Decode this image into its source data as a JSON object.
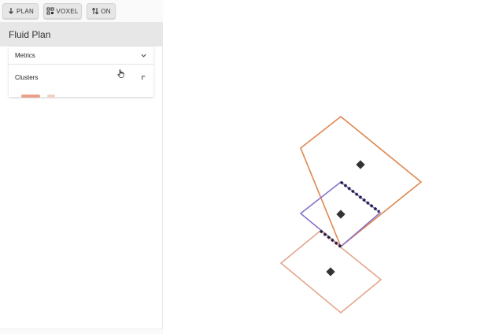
{
  "toolbar": {
    "plan_label": "PLAN",
    "voxel_label": "VOXEL",
    "toggle_label": "ON"
  },
  "panel": {
    "title": "Fluid Plan",
    "sections": [
      {
        "label": "Metrics",
        "state": "collapsed"
      },
      {
        "label": "Clusters",
        "state": "loading"
      }
    ]
  },
  "colors": {
    "room_top": "#e0864f",
    "room_middle": "#8a72cc",
    "room_bottom": "#e3a68c",
    "toolbar_button": "#e6e6e6",
    "panel_header": "#e7e7e7",
    "chip_accent": "#e8a089"
  },
  "icons": {
    "plan": "arrow-down-icon",
    "voxel": "grid-icon",
    "toggle": "swap-vertical-icon",
    "metrics_chevron": "chevron-down-icon",
    "clusters_chevron": "corner-icon",
    "cursor": "hand-cursor-icon"
  }
}
